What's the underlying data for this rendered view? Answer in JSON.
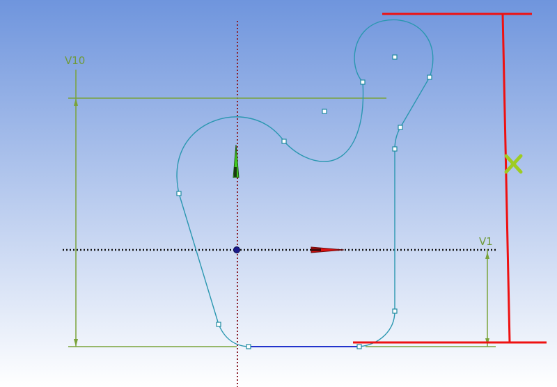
{
  "viewport": {
    "background_top": "#6f95dd",
    "background_bottom": "#ffffff"
  },
  "colors": {
    "sketch": "#2a97b0",
    "dimension": "#7aa33a",
    "constraint_red": "#ee1111",
    "axis_black": "#111111",
    "axis_vertical": "#8a1f2a",
    "selected_edge": "#2233cc",
    "origin": "#1a1a8a",
    "triad_green": "#44cc22",
    "triad_red": "#dd1111",
    "marker": "#9ecc22"
  },
  "dimensions": {
    "v10": {
      "label": "V10"
    },
    "v1": {
      "label": "V1"
    }
  },
  "icons": {
    "origin": "origin-point-icon",
    "y_arrow": "y-axis-arrow-icon",
    "x_arrow": "x-axis-arrow-icon",
    "marker": "x-cross-marker-icon"
  }
}
